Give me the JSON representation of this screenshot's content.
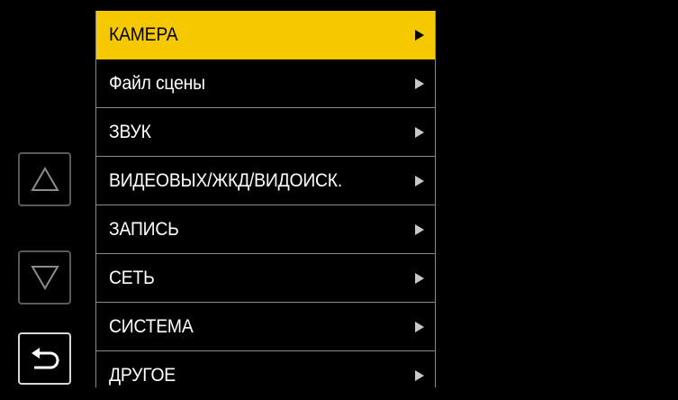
{
  "nav": {
    "up_icon": "triangle-up-outline-icon",
    "down_icon": "triangle-down-outline-icon",
    "back_icon": "return-arrow-icon"
  },
  "menu": {
    "selected_index": 0,
    "items": [
      {
        "label": "КАМЕРА"
      },
      {
        "label": "Файл сцены"
      },
      {
        "label": "ЗВУК"
      },
      {
        "label": "ВИДЕОВЫХ/ЖКД/ВИДОИСК."
      },
      {
        "label": "ЗАПИСЬ"
      },
      {
        "label": "СЕТЬ"
      },
      {
        "label": "СИСТЕМА"
      },
      {
        "label": "ДРУГОЕ"
      }
    ]
  },
  "colors": {
    "highlight": "#f5c800",
    "background": "#000000",
    "text": "#ffffff",
    "divider": "#8a8a8a"
  }
}
